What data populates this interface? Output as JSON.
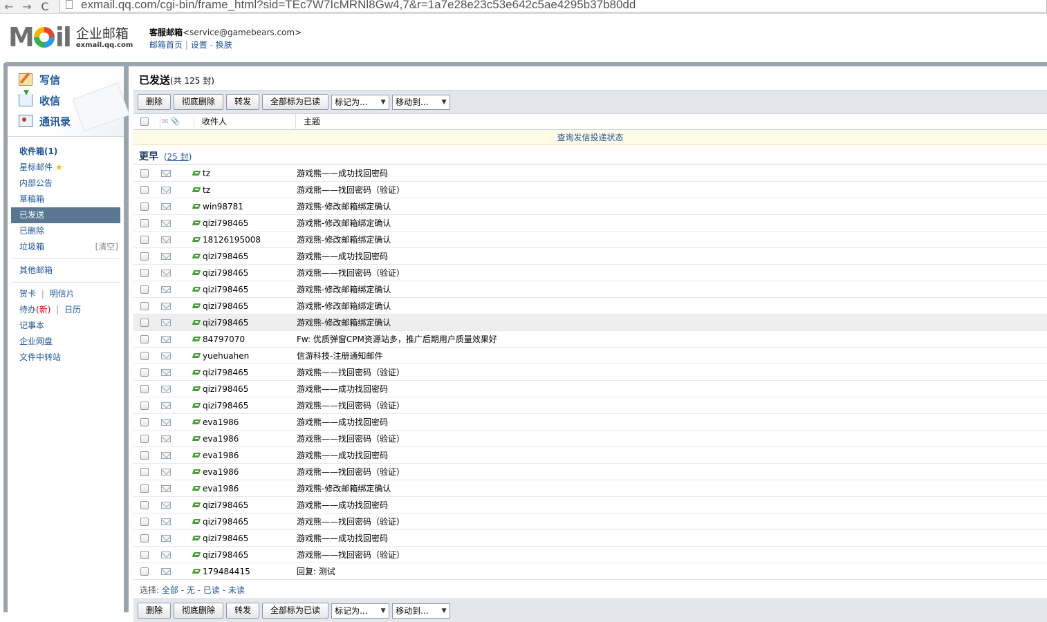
{
  "browser": {
    "back": "←",
    "forward": "→",
    "reload": "C",
    "url": "exmail.qq.com/cgi-bin/frame_html?sid=TEc7W7IcMRNl8Gw4,7&r=1a7e28e23c53e642c5ae4295b37b80dd"
  },
  "header": {
    "logo_left": "M",
    "logo_right": "il",
    "brand_cn": "企业邮箱",
    "brand_en": "exmail.qq.com",
    "account_name": "客服邮箱",
    "account_email": "<service@gamebears.com>",
    "links": [
      "邮箱首页",
      "设置",
      "换肤"
    ],
    "sep1": "|",
    "sep2": "-"
  },
  "sidebar": {
    "write": "写信",
    "receive": "收信",
    "contacts": "通讯录",
    "folders": {
      "inbox": "收件箱(1)",
      "starred": "星标邮件",
      "star": "★",
      "notice": "内部公告",
      "drafts": "草稿箱",
      "sent": "已发送",
      "deleted": "已删除",
      "trash": "垃圾箱",
      "trash_clear": "[清空]",
      "other": "其他邮箱",
      "card": "贺卡",
      "postcard": "明信片",
      "todo": "待办",
      "todo_new": "(新)",
      "calendar": "日历",
      "notes": "记事本",
      "disk": "企业网盘",
      "transfer": "文件中转站",
      "bar": "|"
    }
  },
  "main": {
    "title": "已发送",
    "count": "(共 125 封)",
    "toolbar": {
      "delete": "删除",
      "delete_perm": "彻底删除",
      "forward": "转发",
      "mark_all_read": "全部标为已读",
      "mark_as": "标记为...",
      "move_to": "移动到...",
      "arrow": "▼"
    },
    "columns": {
      "icons": "✉ 📎",
      "recipient": "收件人",
      "subject": "主题"
    },
    "tracking_link": "查询发信投递状态",
    "group_title": "更早",
    "group_count_open": "(",
    "group_count": "25 封",
    "group_count_close": ")",
    "rows": [
      {
        "to": "tz",
        "subject": "游戏熊——成功找回密码"
      },
      {
        "to": "tz",
        "subject": "游戏熊——找回密码（验证）"
      },
      {
        "to": "win98781",
        "subject": "游戏熊-修改邮箱绑定确认"
      },
      {
        "to": "qizi798465",
        "subject": "游戏熊-修改邮箱绑定确认"
      },
      {
        "to": "18126195008",
        "subject": "游戏熊-修改邮箱绑定确认"
      },
      {
        "to": "qizi798465",
        "subject": "游戏熊——成功找回密码"
      },
      {
        "to": "qizi798465",
        "subject": "游戏熊——找回密码（验证）"
      },
      {
        "to": "qizi798465",
        "subject": "游戏熊-修改邮箱绑定确认"
      },
      {
        "to": "qizi798465",
        "subject": "游戏熊-修改邮箱绑定确认"
      },
      {
        "to": "qizi798465",
        "subject": "游戏熊-修改邮箱绑定确认"
      },
      {
        "to": "84797070",
        "subject": "Fw: 优质弹窗CPM资源站多，推广后期用户质量效果好"
      },
      {
        "to": "yuehuahen",
        "subject": "信游科技-注册通知邮件"
      },
      {
        "to": "qizi798465",
        "subject": "游戏熊——找回密码（验证）"
      },
      {
        "to": "qizi798465",
        "subject": "游戏熊——成功找回密码"
      },
      {
        "to": "qizi798465",
        "subject": "游戏熊——找回密码（验证）"
      },
      {
        "to": "eva1986",
        "subject": "游戏熊——成功找回密码"
      },
      {
        "to": "eva1986",
        "subject": "游戏熊——找回密码（验证）"
      },
      {
        "to": "eva1986",
        "subject": "游戏熊——成功找回密码"
      },
      {
        "to": "eva1986",
        "subject": "游戏熊——找回密码（验证）"
      },
      {
        "to": "eva1986",
        "subject": "游戏熊-修改邮箱绑定确认"
      },
      {
        "to": "qizi798465",
        "subject": "游戏熊——成功找回密码"
      },
      {
        "to": "qizi798465",
        "subject": "游戏熊——找回密码（验证）"
      },
      {
        "to": "qizi798465",
        "subject": "游戏熊——成功找回密码"
      },
      {
        "to": "qizi798465",
        "subject": "游戏熊——找回密码（验证）"
      },
      {
        "to": "179484415",
        "subject": "回复: 测试"
      }
    ],
    "select_bar": {
      "prefix": "选择:",
      "all": "全部",
      "none": "无",
      "read": "已读",
      "unread": "未读",
      "dash": "-"
    }
  }
}
